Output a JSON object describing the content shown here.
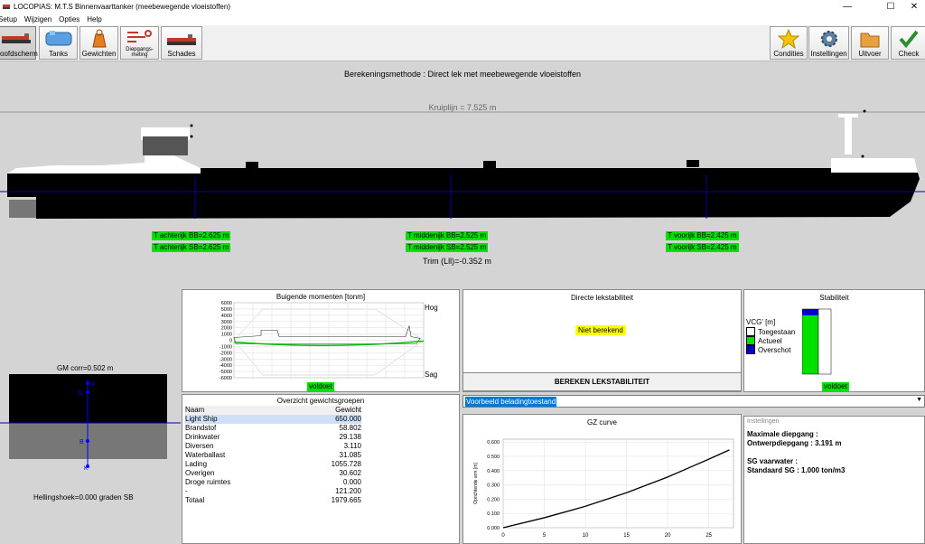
{
  "window": {
    "title": "LOCOPIAS: M.T.S Binnenvaarttanker (meebewegende vloeistoffen)",
    "minimize": "—",
    "maximize": "☐",
    "close": "✕"
  },
  "menu": [
    "Setup",
    "Wijzigen",
    "Opties",
    "Help"
  ],
  "toolbar": {
    "left": [
      {
        "label": "Hoofdscherm",
        "icon": "ship-icon"
      },
      {
        "label": "Tanks",
        "icon": "tanks-icon"
      },
      {
        "label": "Gewichten",
        "icon": "weight-icon"
      },
      {
        "label": "Diepgangs-\nmeting",
        "icon": "draught-icon"
      },
      {
        "label": "Schades",
        "icon": "damage-icon"
      }
    ],
    "right": [
      {
        "label": "Condities",
        "icon": "star-icon"
      },
      {
        "label": "Instellingen",
        "icon": "gear-icon"
      },
      {
        "label": "Uitvoer",
        "icon": "folder-icon"
      },
      {
        "label": "Check",
        "icon": "check-icon"
      }
    ]
  },
  "profile": {
    "method": "Berekeningsmethode : Direct lek met meebewegende vloeistoffen",
    "kruiplijn": "Kruiplijn = 7.525 m",
    "draughts": {
      "aft_bb": "T achterijk BB=2.625 m",
      "aft_sb": "T achterijk SB=2.625 m",
      "mid_bb": "T middenijk BB=2.525 m",
      "mid_sb": "T middenijk SB=2.525 m",
      "fwd_bb": "T voorijk BB=2.425 m",
      "fwd_sb": "T voorijk SB=2.425 m"
    },
    "trim": "Trim (Lll)=-0.352 m"
  },
  "bending": {
    "title": "Buigende momenten [tonm]",
    "yticks": [
      "6000",
      "5000",
      "4000",
      "3000",
      "2000",
      "1000",
      "0",
      "-1000",
      "-2000",
      "-3000",
      "-4000",
      "-5000",
      "-6000"
    ],
    "hog": "Hog",
    "sag": "Sag",
    "status": "voldoet"
  },
  "gm": {
    "title": "GM corr=0.502 m",
    "heeling": "Hellingshoek=0.000 graden SB",
    "marks": {
      "g": "G",
      "b": "B",
      "k": "K",
      "m": "M"
    }
  },
  "weights": {
    "title": "Overzicht gewichtsgroepen",
    "col_name": "Naam",
    "col_weight": "Gewicht",
    "rows": [
      {
        "name": "Light Ship",
        "value": "650.000"
      },
      {
        "name": "Brandstof",
        "value": "58.802"
      },
      {
        "name": "Drinkwater",
        "value": "29.138"
      },
      {
        "name": "Diversen",
        "value": "3.110"
      },
      {
        "name": "Waterballast",
        "value": "31.085"
      },
      {
        "name": "Lading",
        "value": "1055.728"
      },
      {
        "name": "Overigen",
        "value": "30.602"
      },
      {
        "name": "Droge ruimtes",
        "value": "0.000"
      },
      {
        "name": "-",
        "value": "121.200"
      },
      {
        "name": "Totaal",
        "value": "1979.665"
      }
    ]
  },
  "damage": {
    "title": "Directe lekstabiliteit",
    "status": "Niet berekend",
    "button": "BEREKEN LEKSTABILITEIT"
  },
  "stability": {
    "title": "Stabiliteit",
    "vcg": "VCG' [m]",
    "allowed": "Toegestaan",
    "actual": "Actueel",
    "excess": "Overschot",
    "status": "voldoet",
    "colors": {
      "allowed": "#ffffff",
      "actual": "#00e000",
      "excess": "#0000d0"
    }
  },
  "condition": {
    "selected": "Voorbeeld beladingtoestand"
  },
  "chart_data": {
    "type": "line",
    "title": "GZ curve",
    "ylabel": "Oprichtende arm [m]",
    "xlabel": "",
    "x": [
      0,
      5,
      10,
      15,
      20,
      25,
      27.5
    ],
    "y": [
      0.0,
      0.07,
      0.15,
      0.245,
      0.355,
      0.48,
      0.545
    ],
    "xticks": [
      0,
      5,
      10,
      15,
      20,
      25
    ],
    "yticks": [
      "0.000",
      "0.100",
      "0.200",
      "0.300",
      "0.400",
      "0.500",
      "0.600"
    ],
    "xlim": [
      0,
      28
    ],
    "ylim": [
      0,
      0.62
    ],
    "grid": true
  },
  "settings": {
    "title": "Instellingen",
    "max_draught": "Maximale diepgang :",
    "design_draught": "Ontwerpdiepgang : 3.191 m",
    "sg_label": "SG vaarwater :",
    "sg_value": "Standaard SG : 1.000 ton/m3"
  }
}
